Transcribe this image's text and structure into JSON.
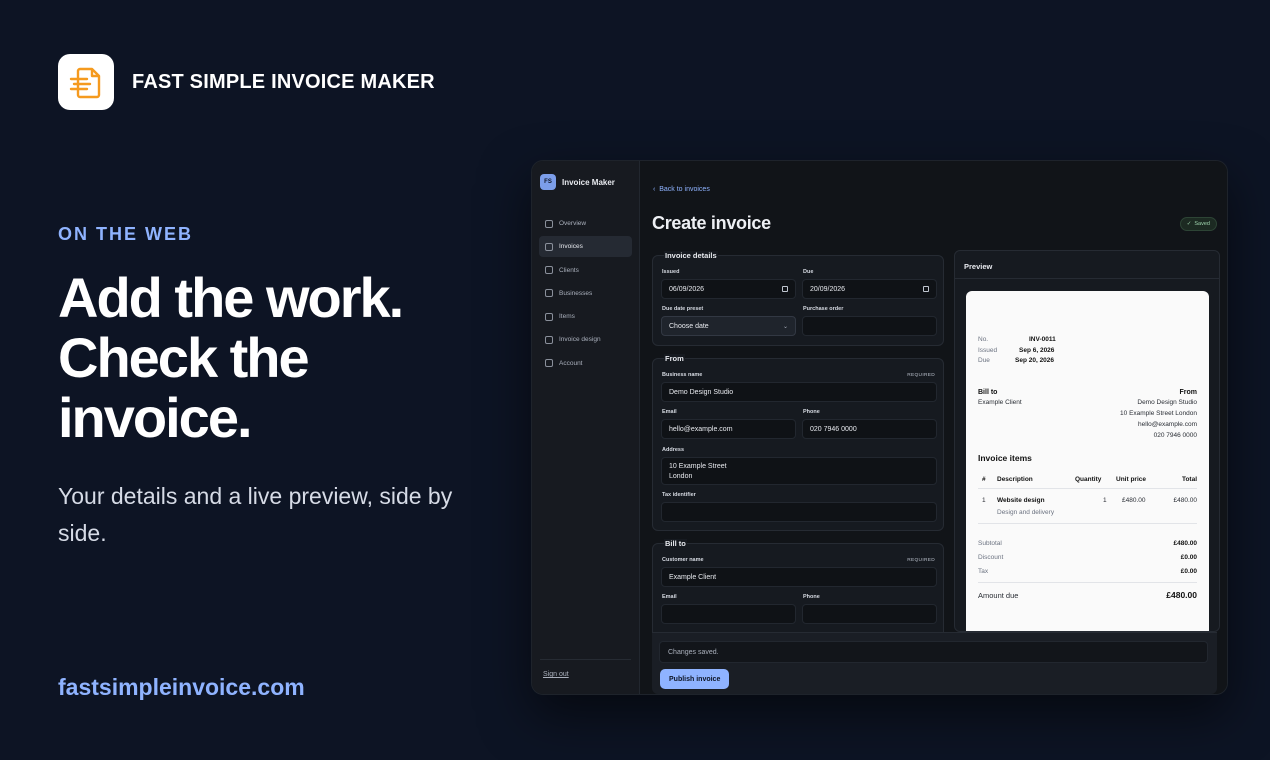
{
  "brand": {
    "name": "FAST SIMPLE INVOICE MAKER",
    "icon": "invoice-logo-icon"
  },
  "hero": {
    "eyebrow": "ON THE WEB",
    "headline": [
      "Add the work.",
      "Check the",
      "invoice."
    ],
    "subtitle": "Your details and a live preview, side by side.",
    "url": "fastsimpleinvoice.com"
  },
  "app": {
    "sidebar": {
      "avatar": "FS",
      "title": "Invoice Maker",
      "items": [
        {
          "label": "Overview",
          "icon": "grid-icon"
        },
        {
          "label": "Invoices",
          "icon": "document-icon"
        },
        {
          "label": "Clients",
          "icon": "users-icon"
        },
        {
          "label": "Businesses",
          "icon": "briefcase-icon"
        },
        {
          "label": "Items",
          "icon": "box-icon"
        },
        {
          "label": "Invoice design",
          "icon": "palette-icon"
        },
        {
          "label": "Account",
          "icon": "user-icon"
        }
      ],
      "active_index": 1,
      "sign_out": "Sign out"
    },
    "back_link": "Back to invoices",
    "page_title": "Create invoice",
    "saved_badge": "Saved",
    "invoice_details": {
      "title": "Invoice details",
      "issued_label": "Issued",
      "issued_value": "06/09/2026",
      "due_label": "Due",
      "due_value": "20/09/2026",
      "preset_label": "Due date preset",
      "preset_value": "Choose date",
      "po_label": "Purchase order",
      "po_value": ""
    },
    "from": {
      "title": "From",
      "business_label": "Business name",
      "required": "REQUIRED",
      "business_value": "Demo Design Studio",
      "email_label": "Email",
      "email_value": "hello@example.com",
      "phone_label": "Phone",
      "phone_value": "020 7946 0000",
      "address_label": "Address",
      "address_line1": "10 Example Street",
      "address_line2": "London",
      "tax_label": "Tax identifier",
      "tax_value": ""
    },
    "bill_to": {
      "title": "Bill to",
      "customer_label": "Customer name",
      "required": "REQUIRED",
      "customer_value": "Example Client",
      "email_label": "Email",
      "phone_label": "Phone"
    },
    "preview": {
      "title": "Preview",
      "no_label": "No.",
      "no_value": "INV-0011",
      "issued_label": "Issued",
      "issued_value": "Sep 6, 2026",
      "due_label": "Due",
      "due_value": "Sep 20, 2026",
      "bill_to_label": "Bill to",
      "bill_to_value": "Example Client",
      "from_label": "From",
      "from_lines": [
        "Demo Design Studio",
        "10 Example Street London",
        "hello@example.com",
        "020 7946 0000"
      ],
      "items_title": "Invoice items",
      "columns": [
        "#",
        "Description",
        "Quantity",
        "Unit price",
        "Total"
      ],
      "row": {
        "num": "1",
        "desc": "Website design",
        "sub": "Design and delivery",
        "qty": "1",
        "unit": "£480.00",
        "total": "£480.00"
      },
      "subtotal_label": "Subtotal",
      "subtotal_value": "£480.00",
      "discount_label": "Discount",
      "discount_value": "£0.00",
      "tax_label": "Tax",
      "tax_value": "£0.00",
      "amount_due_label": "Amount due",
      "amount_due_value": "£480.00"
    },
    "footer": {
      "message": "Changes saved.",
      "publish_label": "Publish invoice"
    }
  }
}
